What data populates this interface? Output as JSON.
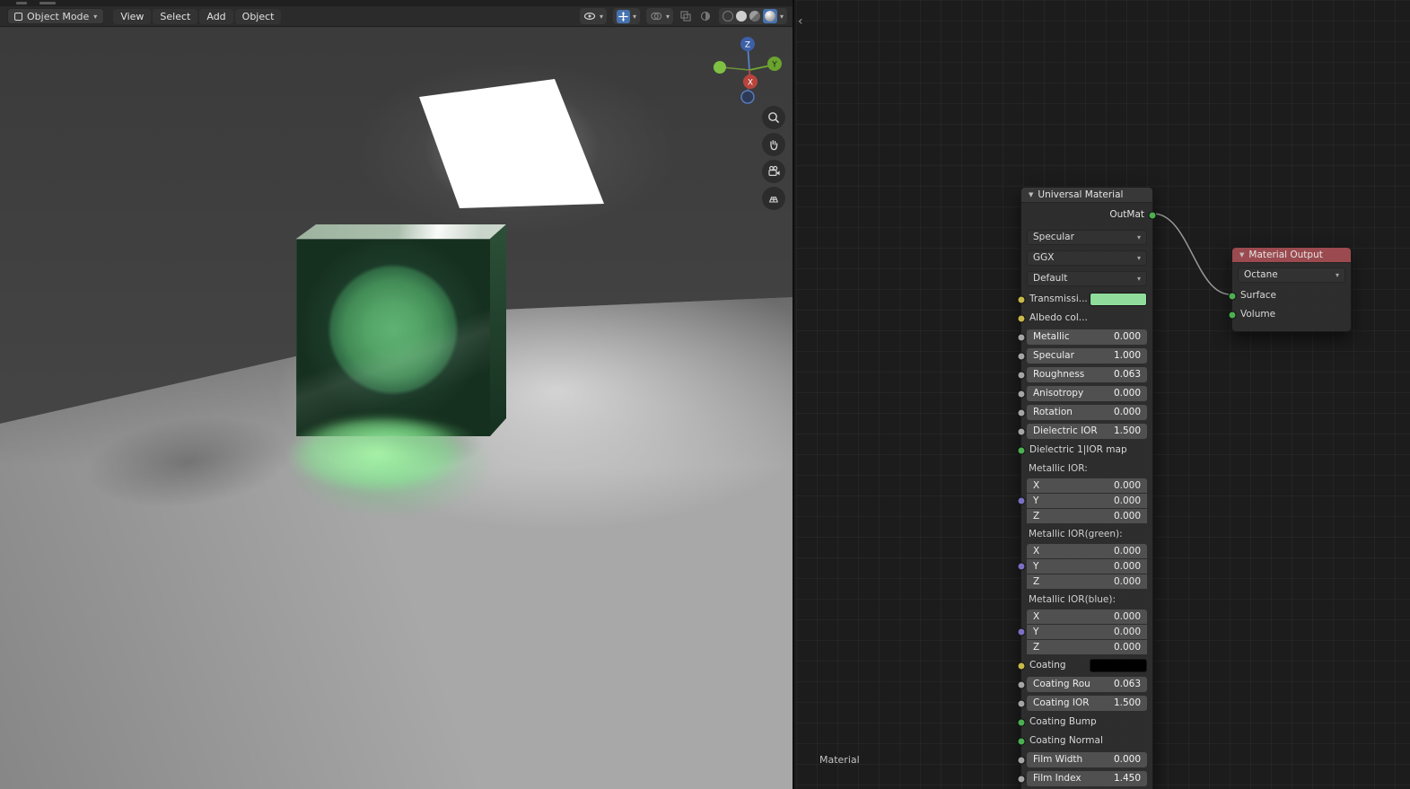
{
  "viewport": {
    "header": {
      "mode": "Object Mode",
      "menus": [
        "View",
        "Select",
        "Add",
        "Object"
      ]
    },
    "axis_gizmo": {
      "x": "X",
      "y": "Y",
      "z": "Z"
    }
  },
  "node_editor": {
    "footer_label": "Material",
    "colors": {
      "socket_yellow": "#c8b84a",
      "socket_gray": "#a5a5a5",
      "socket_purple": "#7a70c2",
      "socket_green": "#4caf50",
      "output_header": "#9b4a4f"
    },
    "universal_material": {
      "title": "Universal Material",
      "output": "OutMat",
      "rows": [
        {
          "type": "dropdown",
          "label": "Specular"
        },
        {
          "type": "dropdown",
          "label": "GGX"
        },
        {
          "type": "dropdown",
          "label": "Default"
        },
        {
          "type": "color",
          "label": "Transmissi...",
          "swatch": "#90dd9b",
          "socket": "yellow"
        },
        {
          "type": "label",
          "label": "Albedo col...",
          "socket": "yellow"
        },
        {
          "type": "slider",
          "label": "Metallic",
          "value": "0.000",
          "socket": "gray"
        },
        {
          "type": "slider",
          "label": "Specular",
          "value": "1.000",
          "socket": "gray"
        },
        {
          "type": "slider",
          "label": "Roughness",
          "value": "0.063",
          "socket": "gray"
        },
        {
          "type": "slider",
          "label": "Anisotropy",
          "value": "0.000",
          "socket": "gray"
        },
        {
          "type": "slider",
          "label": "Rotation",
          "value": "0.000",
          "socket": "gray"
        },
        {
          "type": "slider",
          "label": "Dielectric IOR",
          "value": "1.500",
          "socket": "gray"
        },
        {
          "type": "label",
          "label": "Dielectric 1|IOR map",
          "socket": "green"
        },
        {
          "type": "heading",
          "label": "Metallic IOR:"
        },
        {
          "type": "vector",
          "labels": [
            "X",
            "Y",
            "Z"
          ],
          "values": [
            "0.000",
            "0.000",
            "0.000"
          ],
          "socket": "purple"
        },
        {
          "type": "heading",
          "label": "Metallic IOR(green):"
        },
        {
          "type": "vector",
          "labels": [
            "X",
            "Y",
            "Z"
          ],
          "values": [
            "0.000",
            "0.000",
            "0.000"
          ],
          "socket": "purple"
        },
        {
          "type": "heading",
          "label": "Metallic IOR(blue):"
        },
        {
          "type": "vector",
          "labels": [
            "X",
            "Y",
            "Z"
          ],
          "values": [
            "0.000",
            "0.000",
            "0.000"
          ],
          "socket": "purple"
        },
        {
          "type": "color",
          "label": "Coating",
          "swatch": "#000000",
          "socket": "yellow"
        },
        {
          "type": "slider",
          "label": "Coating Rou",
          "value": "0.063",
          "socket": "gray"
        },
        {
          "type": "slider",
          "label": "Coating IOR",
          "value": "1.500",
          "socket": "gray"
        },
        {
          "type": "label",
          "label": "Coating Bump",
          "socket": "green"
        },
        {
          "type": "label",
          "label": "Coating Normal",
          "socket": "green"
        },
        {
          "type": "slider",
          "label": "Film Width",
          "value": "0.000",
          "socket": "gray"
        },
        {
          "type": "slider",
          "label": "Film Index",
          "value": "1.450",
          "socket": "gray"
        }
      ]
    },
    "material_output": {
      "title": "Material Output",
      "renderer": "Octane",
      "inputs": [
        {
          "label": "Surface",
          "socket": "green"
        },
        {
          "label": "Volume",
          "socket": "green"
        }
      ]
    }
  }
}
